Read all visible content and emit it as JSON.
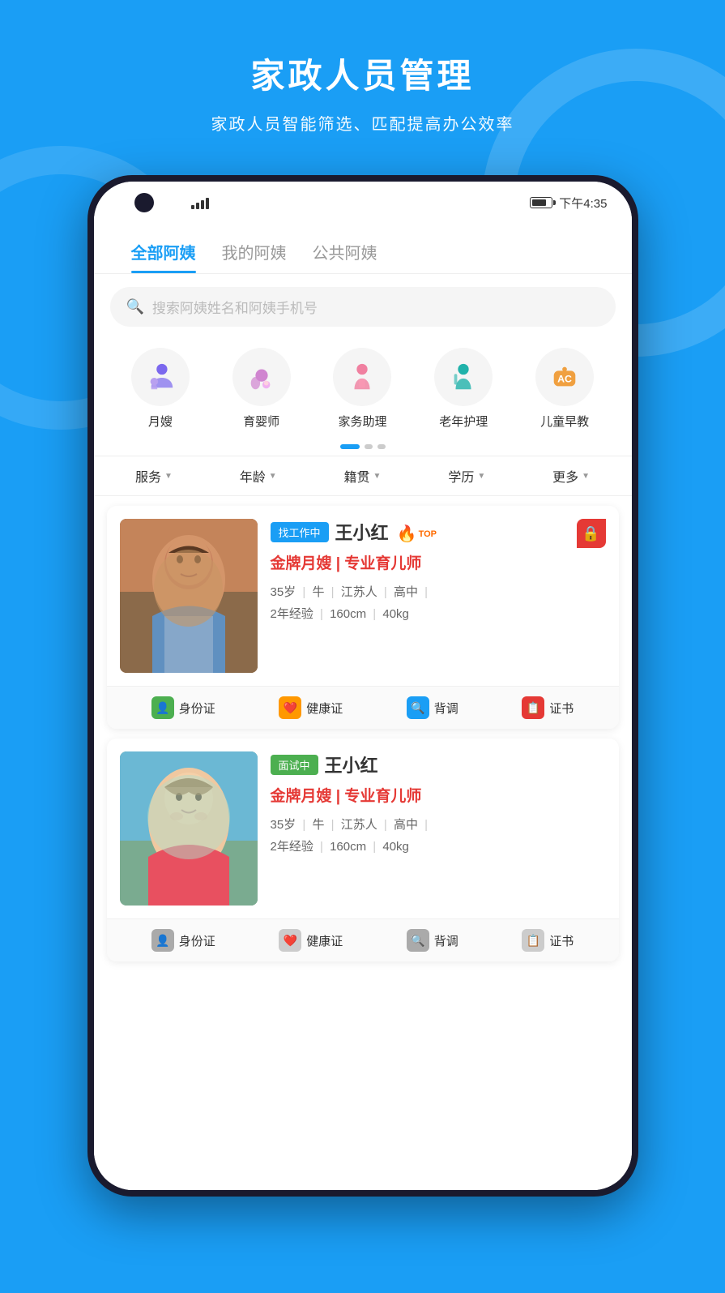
{
  "header": {
    "title": "家政人员管理",
    "subtitle": "家政人员智能筛选、匹配提高办公效率"
  },
  "status_bar": {
    "time": "下午4:35"
  },
  "tabs": [
    {
      "label": "全部阿姨",
      "active": true
    },
    {
      "label": "我的阿姨",
      "active": false
    },
    {
      "label": "公共阿姨",
      "active": false
    }
  ],
  "search": {
    "placeholder": "搜索阿姨姓名和阿姨手机号"
  },
  "categories": [
    {
      "label": "月嫂",
      "icon": "👩‍🍼"
    },
    {
      "label": "育婴师",
      "icon": "👶"
    },
    {
      "label": "家务助理",
      "icon": "👩‍🏠"
    },
    {
      "label": "老年护理",
      "icon": "👴"
    },
    {
      "label": "儿童早教",
      "icon": "🎲"
    }
  ],
  "filters": [
    {
      "label": "服务"
    },
    {
      "label": "年龄"
    },
    {
      "label": "籍贯"
    },
    {
      "label": "学历"
    },
    {
      "label": "更多"
    }
  ],
  "cards": [
    {
      "status": "找工作中",
      "status_type": "working",
      "name": "王小红",
      "title": "金牌月嫂 | 专业育儿师",
      "age": "35岁",
      "zodiac": "牛",
      "origin": "江苏人",
      "education": "高中",
      "experience": "2年经验",
      "height": "160cm",
      "weight": "40kg",
      "has_lock": true,
      "credentials": [
        {
          "label": "身份证",
          "type": "id"
        },
        {
          "label": "健康证",
          "type": "health"
        },
        {
          "label": "背调",
          "type": "bg"
        },
        {
          "label": "证书",
          "type": "cert"
        }
      ]
    },
    {
      "status": "面试中",
      "status_type": "interview",
      "name": "王小红",
      "title": "金牌月嫂 | 专业育儿师",
      "age": "35岁",
      "zodiac": "牛",
      "origin": "江苏人",
      "education": "高中",
      "experience": "2年经验",
      "height": "160cm",
      "weight": "40kg",
      "has_lock": false,
      "credentials": [
        {
          "label": "身份证",
          "type": "id-gray"
        },
        {
          "label": "健康证",
          "type": "health-gray"
        },
        {
          "label": "背调",
          "type": "bg-gray"
        },
        {
          "label": "证书",
          "type": "cert-gray"
        }
      ]
    }
  ]
}
